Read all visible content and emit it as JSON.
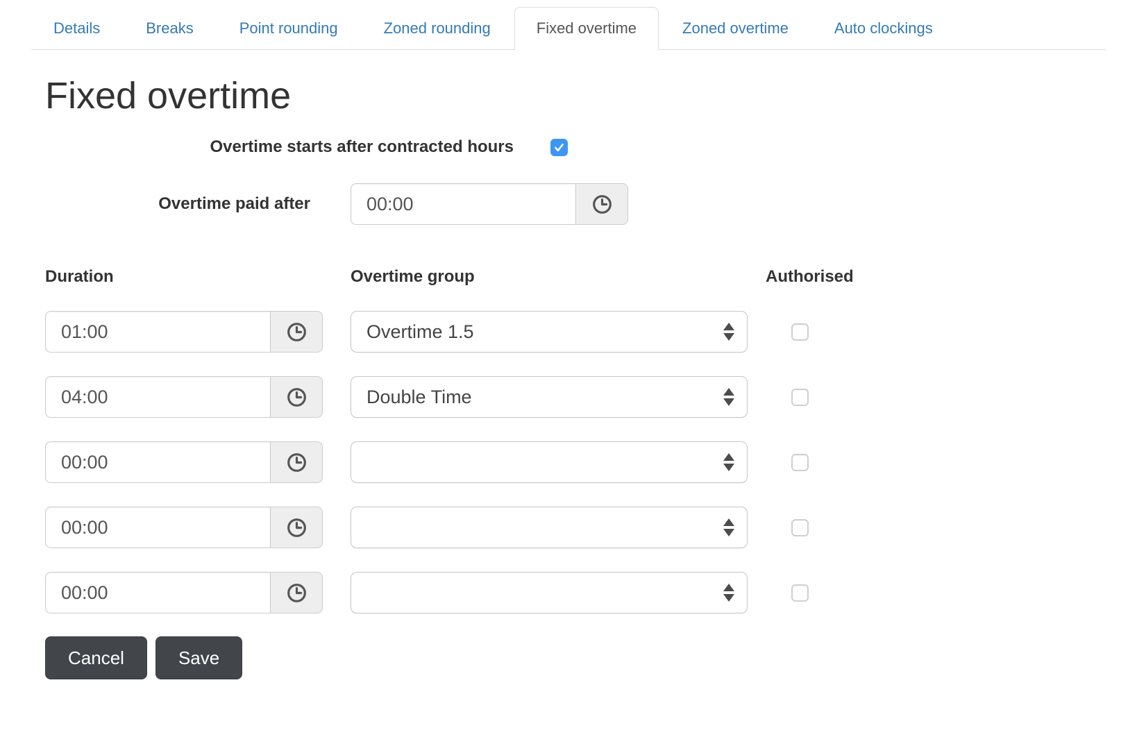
{
  "tabs": [
    {
      "label": "Details",
      "active": false
    },
    {
      "label": "Breaks",
      "active": false
    },
    {
      "label": "Point rounding",
      "active": false
    },
    {
      "label": "Zoned rounding",
      "active": false
    },
    {
      "label": "Fixed overtime",
      "active": true
    },
    {
      "label": "Zoned overtime",
      "active": false
    },
    {
      "label": "Auto clockings",
      "active": false
    }
  ],
  "page": {
    "title": "Fixed overtime"
  },
  "form": {
    "contracted": {
      "label": "Overtime starts after contracted hours",
      "checked": true
    },
    "paid_after": {
      "label": "Overtime paid after",
      "value": "00:00"
    },
    "columns": {
      "duration": "Duration",
      "group": "Overtime group",
      "authorised": "Authorised"
    },
    "rows": [
      {
        "duration": "01:00",
        "group": "Overtime 1.5",
        "authorised": false
      },
      {
        "duration": "04:00",
        "group": "Double Time",
        "authorised": false
      },
      {
        "duration": "00:00",
        "group": "",
        "authorised": false
      },
      {
        "duration": "00:00",
        "group": "",
        "authorised": false
      },
      {
        "duration": "00:00",
        "group": "",
        "authorised": false
      }
    ],
    "buttons": {
      "cancel": "Cancel",
      "save": "Save"
    }
  },
  "colors": {
    "tab_link": "#337ab7",
    "active_tab_text": "#555555",
    "checkbox_checked": "#3d96f5",
    "button_background": "#42464b",
    "input_border": "#cccccc",
    "addon_background": "#eeeeee"
  },
  "icons": {
    "time_addon": "clock-icon",
    "select_caret": "up-down-arrows-icon",
    "check": "checkmark-icon"
  }
}
